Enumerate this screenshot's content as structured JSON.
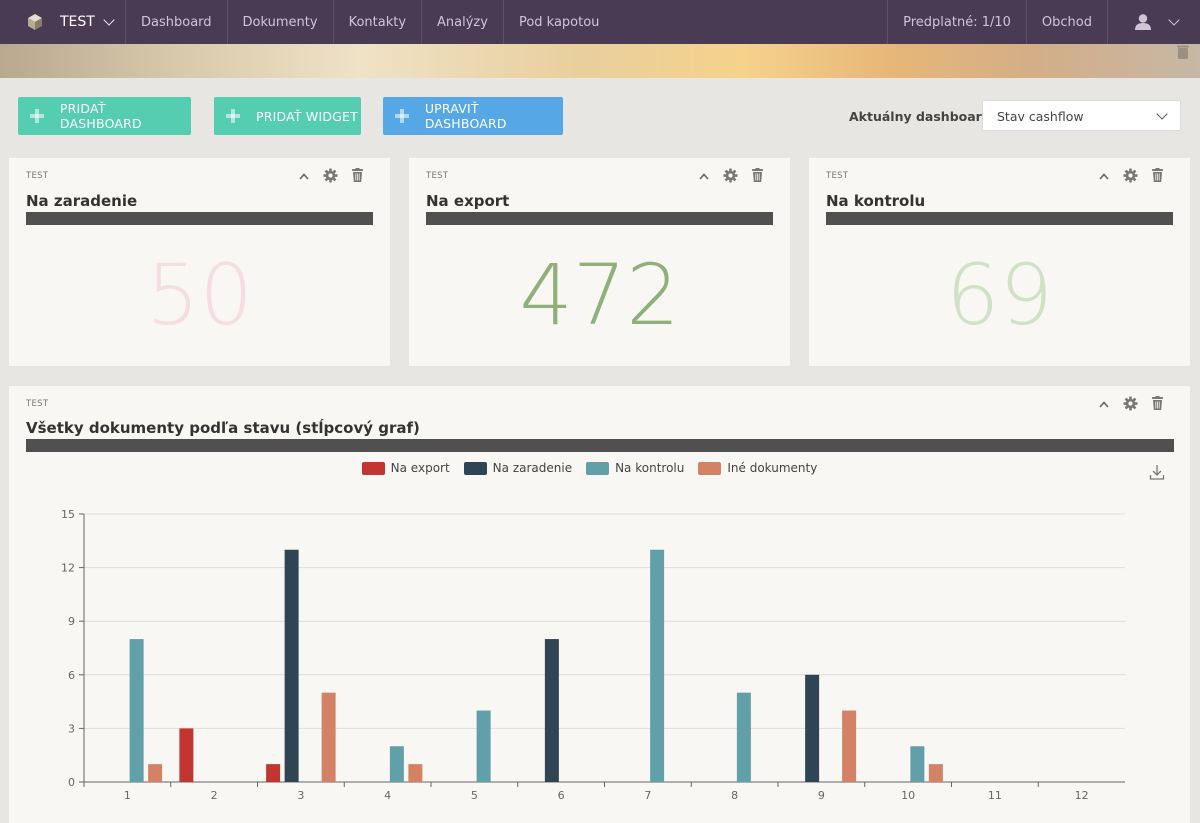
{
  "nav": {
    "brand": "TEST",
    "items": [
      "Dashboard",
      "Dokumenty",
      "Kontakty",
      "Analýzy",
      "Pod kapotou"
    ],
    "subscription": "Predplatné: 1/10",
    "shop": "Obchod"
  },
  "actions": {
    "add_dashboard": "PRIDAŤ DASHBOARD",
    "add_widget": "PRIDAŤ WIDGET",
    "edit_dashboard": "UPRAVIŤ DASHBOARD",
    "current_dashboard_label": "Aktuálny dashboard",
    "current_dashboard_value": "Stav cashflow"
  },
  "widgets": [
    {
      "tag": "TEST",
      "title": "Na zaradenie",
      "value": "50",
      "color": "#f4dede"
    },
    {
      "tag": "TEST",
      "title": "Na export",
      "value": "472",
      "color": "#8fb07a"
    },
    {
      "tag": "TEST",
      "title": "Na kontrolu",
      "value": "69",
      "color": "#cfe2c4"
    }
  ],
  "chart_widget": {
    "tag": "TEST",
    "title": "Všetky dokumenty podľa stavu (stĺpcový graf)"
  },
  "chart_data": {
    "type": "bar",
    "categories": [
      "1",
      "2",
      "3",
      "4",
      "5",
      "6",
      "7",
      "8",
      "9",
      "10",
      "11",
      "12"
    ],
    "ylim": [
      0,
      15
    ],
    "yticks": [
      0,
      3,
      6,
      9,
      12,
      15
    ],
    "grid": true,
    "legend": "top-center",
    "series": [
      {
        "name": "Na export",
        "color": "#c23531",
        "values": [
          0,
          3,
          1,
          0,
          0,
          0,
          0,
          0,
          0,
          0,
          0,
          0
        ]
      },
      {
        "name": "Na zaradenie",
        "color": "#2f4554",
        "values": [
          0,
          0,
          13,
          0,
          0,
          8,
          0,
          0,
          6,
          0,
          0,
          0
        ]
      },
      {
        "name": "Na kontrolu",
        "color": "#61a0a8",
        "values": [
          8,
          0,
          0,
          2,
          4,
          0,
          13,
          5,
          0,
          2,
          0,
          0
        ]
      },
      {
        "name": "Iné dokumenty",
        "color": "#d48265",
        "values": [
          1,
          0,
          5,
          1,
          0,
          0,
          0,
          0,
          4,
          1,
          0,
          0
        ]
      }
    ]
  }
}
